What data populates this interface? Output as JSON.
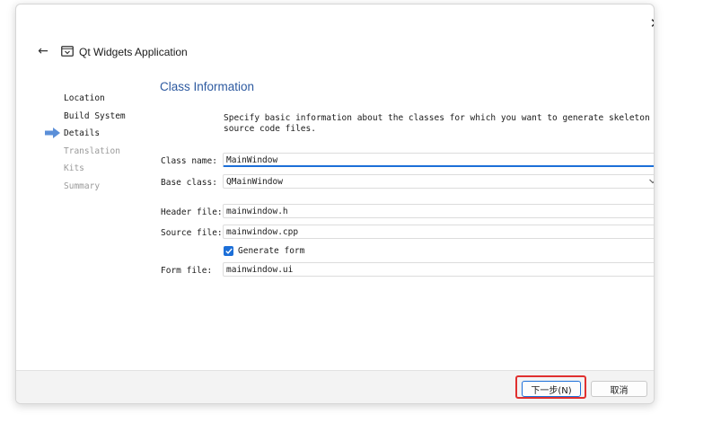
{
  "window": {
    "close_symbol": "✕"
  },
  "header": {
    "back_symbol": "←",
    "title": "Qt Widgets Application"
  },
  "sidebar": {
    "items": [
      {
        "label": "Location",
        "state": "done"
      },
      {
        "label": "Build System",
        "state": "done"
      },
      {
        "label": "Details",
        "state": "current"
      },
      {
        "label": "Translation",
        "state": "pending"
      },
      {
        "label": "Kits",
        "state": "pending"
      },
      {
        "label": "Summary",
        "state": "pending"
      }
    ]
  },
  "page": {
    "title": "Class Information",
    "description": "Specify basic information about the classes for which you want to generate skeleton source code files."
  },
  "form": {
    "class_name": {
      "label": "Class name:",
      "value": "MainWindow"
    },
    "base_class": {
      "label": "Base class:",
      "value": "QMainWindow"
    },
    "header_file": {
      "label": "Header file:",
      "value": "mainwindow.h"
    },
    "source_file": {
      "label": "Source file:",
      "value": "mainwindow.cpp"
    },
    "generate_form": {
      "label": "Generate form",
      "checked": true
    },
    "form_file": {
      "label": "Form file:",
      "value": "mainwindow.ui"
    }
  },
  "footer": {
    "next_label": "下一步(N)",
    "cancel_label": "取消"
  },
  "colors": {
    "accent": "#1c6fd8",
    "title": "#2d5aa0",
    "highlight": "#e0302f"
  }
}
